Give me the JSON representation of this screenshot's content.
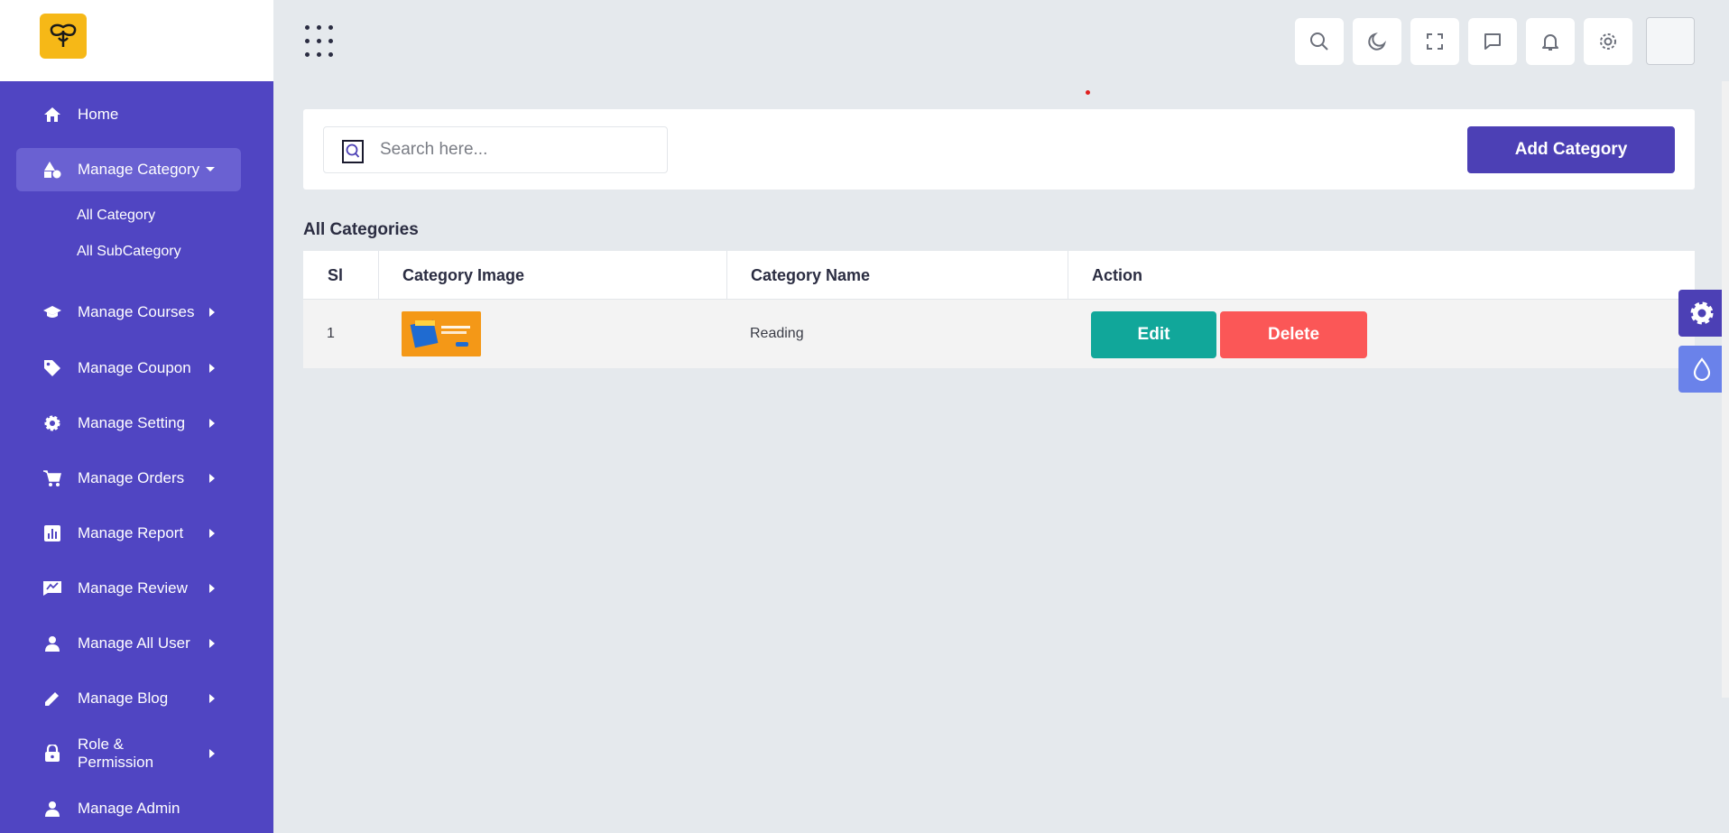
{
  "header": {
    "logo_icon": "bee-logo-icon",
    "apps_icon": "apps-grid-icon",
    "buttons": [
      "search-icon",
      "moon-icon",
      "fullscreen-icon",
      "chat-icon",
      "bell-icon",
      "gear-icon"
    ]
  },
  "sidebar": {
    "items": [
      {
        "label": "Home",
        "icon": "home-icon"
      },
      {
        "label": "Manage Category",
        "icon": "shapes-icon"
      },
      {
        "label": "Manage Courses",
        "icon": "graduation-cap-icon"
      },
      {
        "label": "Manage Coupon",
        "icon": "tag-icon"
      },
      {
        "label": "Manage Setting",
        "icon": "gear-icon"
      },
      {
        "label": "Manage Orders",
        "icon": "cart-icon"
      },
      {
        "label": "Manage Report",
        "icon": "chart-icon"
      },
      {
        "label": "Manage Review",
        "icon": "review-icon"
      },
      {
        "label": "Manage All User",
        "icon": "user-icon"
      },
      {
        "label": "Manage Blog",
        "icon": "pencil-icon"
      },
      {
        "label": "Role & Permission",
        "icon": "lock-icon"
      },
      {
        "label": "Manage Admin",
        "icon": "user-icon"
      }
    ],
    "subitems": [
      "All Category",
      "All SubCategory"
    ]
  },
  "search": {
    "placeholder": "Search here..."
  },
  "actions": {
    "add_label": "Add Category"
  },
  "section_title": "All Categories",
  "table": {
    "headers": [
      "Sl",
      "Category Image",
      "Category Name",
      "Action"
    ],
    "rows": [
      {
        "sl": "1",
        "name": "Reading",
        "edit": "Edit",
        "delete": "Delete"
      }
    ]
  },
  "colors": {
    "sidebar": "#5045c2",
    "primary": "#4c40b5",
    "edit": "#11a79a",
    "delete": "#fb5757",
    "logo": "#f6b817"
  }
}
